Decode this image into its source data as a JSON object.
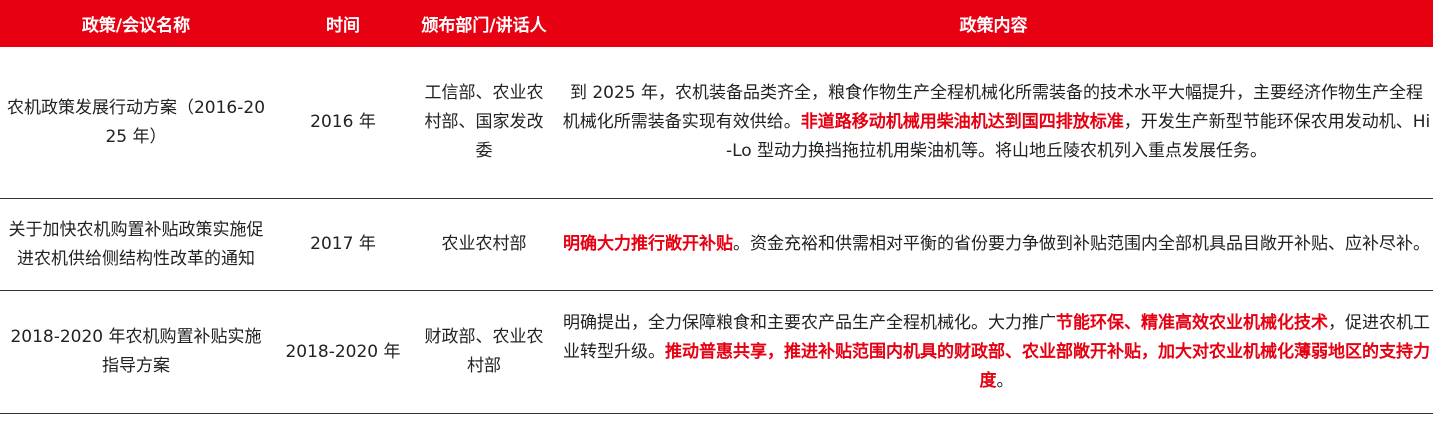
{
  "header": {
    "col_name": "政策/会议名称",
    "col_time": "时间",
    "col_dept": "颁布部门/讲话人",
    "col_content": "政策内容"
  },
  "rows": [
    {
      "name": "农机政策发展行动方案（2016-2025 年）",
      "time": "2016 年",
      "dept": "工信部、农业农村部、国家发改委",
      "content": [
        {
          "text": "到 2025 年，农机装备品类齐全，粮食作物生产全程机械化所需装备的技术水平大幅提升，主要经济作物生产全程机械化所需装备实现有效供给。",
          "highlight": false
        },
        {
          "text": "非道路移动机械用柴油机达到国四排放标准",
          "highlight": true
        },
        {
          "text": "，开发生产新型节能环保农用发动机、Hi-Lo 型动力换挡拖拉机用柴油机等。将山地丘陵农机列入重点发展任务。",
          "highlight": false
        }
      ]
    },
    {
      "name": "关于加快农机购置补贴政策实施促进农机供给侧结构性改革的通知",
      "time": "2017 年",
      "dept": "农业农村部",
      "content": [
        {
          "text": "明确大力推行敞开补贴",
          "highlight": true
        },
        {
          "text": "。资金充裕和供需相对平衡的省份要力争做到补贴范围内全部机具品目敞开补贴、应补尽补。",
          "highlight": false
        }
      ]
    },
    {
      "name": "2018-2020 年农机购置补贴实施指导方案",
      "time": "2018-2020 年",
      "dept": "财政部、农业农村部",
      "content": [
        {
          "text": "明确提出，全力保障粮食和主要农产品生产全程机械化。大力推广",
          "highlight": false
        },
        {
          "text": "节能环保、精准高效农业机械化技术",
          "highlight": true
        },
        {
          "text": "，促进农机工业转型升级。",
          "highlight": false
        },
        {
          "text": "推动普惠共享，推进补贴范围内机具的财政部、农业部敞开补贴，加大对农业机械化薄弱地区的支持力度",
          "highlight": true
        },
        {
          "text": "。",
          "highlight": false
        }
      ]
    }
  ],
  "colors": {
    "header_bg": "#e60012",
    "highlight": "#e60012"
  }
}
